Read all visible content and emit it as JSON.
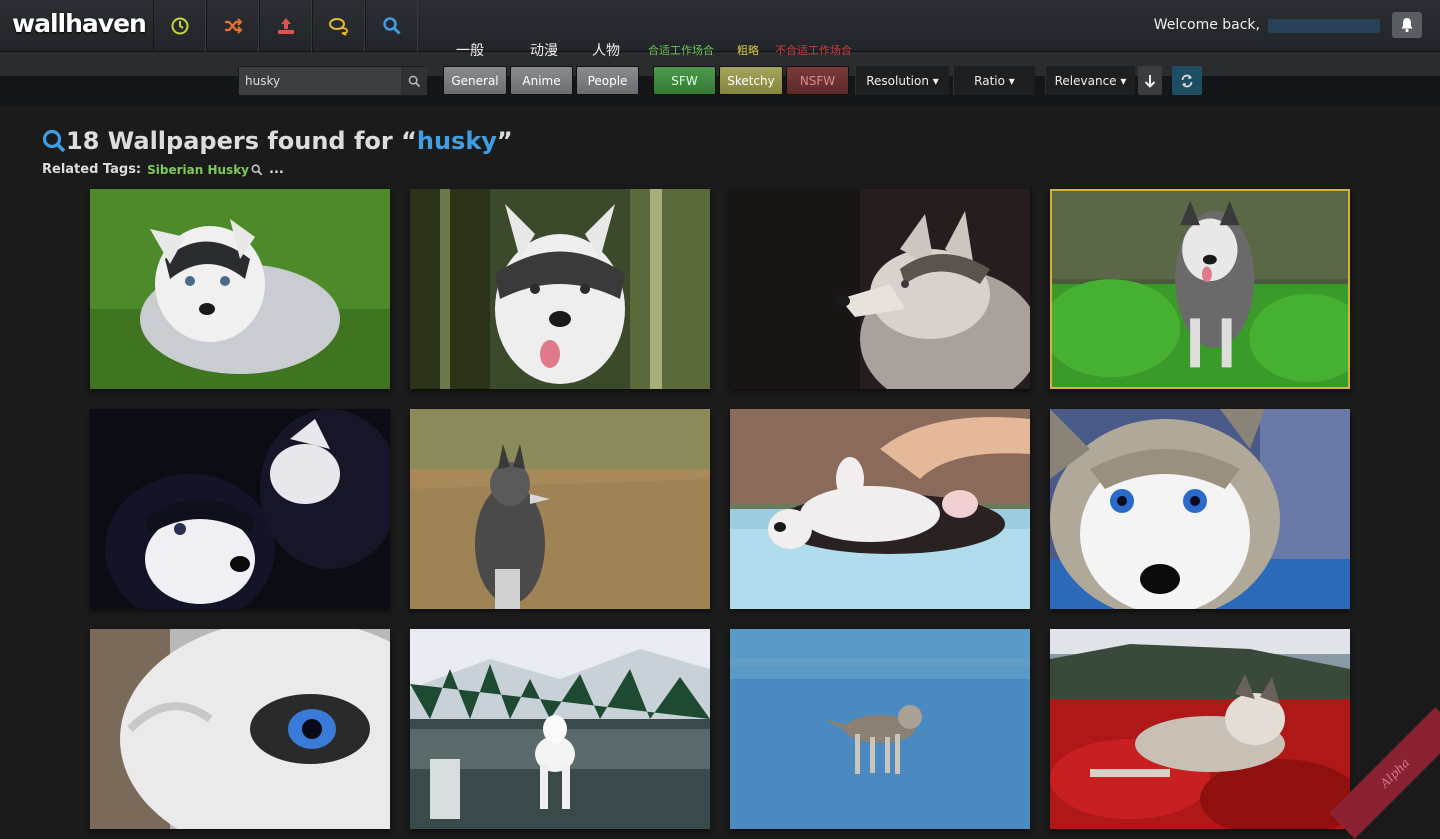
{
  "app": {
    "logo": "wallhaven"
  },
  "nav": {
    "icons": [
      {
        "name": "latest-icon",
        "color": "#c9d43a"
      },
      {
        "name": "random-icon",
        "color": "#e8702e"
      },
      {
        "name": "upload-icon",
        "color": "#e25050"
      },
      {
        "name": "forums-icon",
        "color": "#e8b92c"
      },
      {
        "name": "search-icon",
        "color": "#3f9fe5"
      }
    ]
  },
  "header": {
    "welcome": "Welcome back,"
  },
  "annotations": {
    "general_cn": "一般",
    "anime_cn": "动漫",
    "people_cn": "人物",
    "sfw_cn": "合适工作场合",
    "sketchy_cn": "粗略",
    "nsfw_cn": "不合适工作场合"
  },
  "search": {
    "value": "husky"
  },
  "filters": {
    "general": "General",
    "anime": "Anime",
    "people": "People",
    "sfw": "SFW",
    "sketchy": "Sketchy",
    "nsfw": "NSFW",
    "resolution": "Resolution ▾",
    "ratio": "Ratio ▾",
    "relevance": "Relevance ▾"
  },
  "results": {
    "count_text": "18 Wallpapers found for “",
    "query": "husky",
    "close_quote": "”",
    "related_label": "Related Tags:",
    "related_tag": "Siberian Husky",
    "more": "..."
  },
  "colors": {
    "accent_blue": "#3f9fe5",
    "tag_green": "#7ecb5a",
    "selected_border": "#d7b13f"
  },
  "badge": {
    "text": "Alpha"
  }
}
